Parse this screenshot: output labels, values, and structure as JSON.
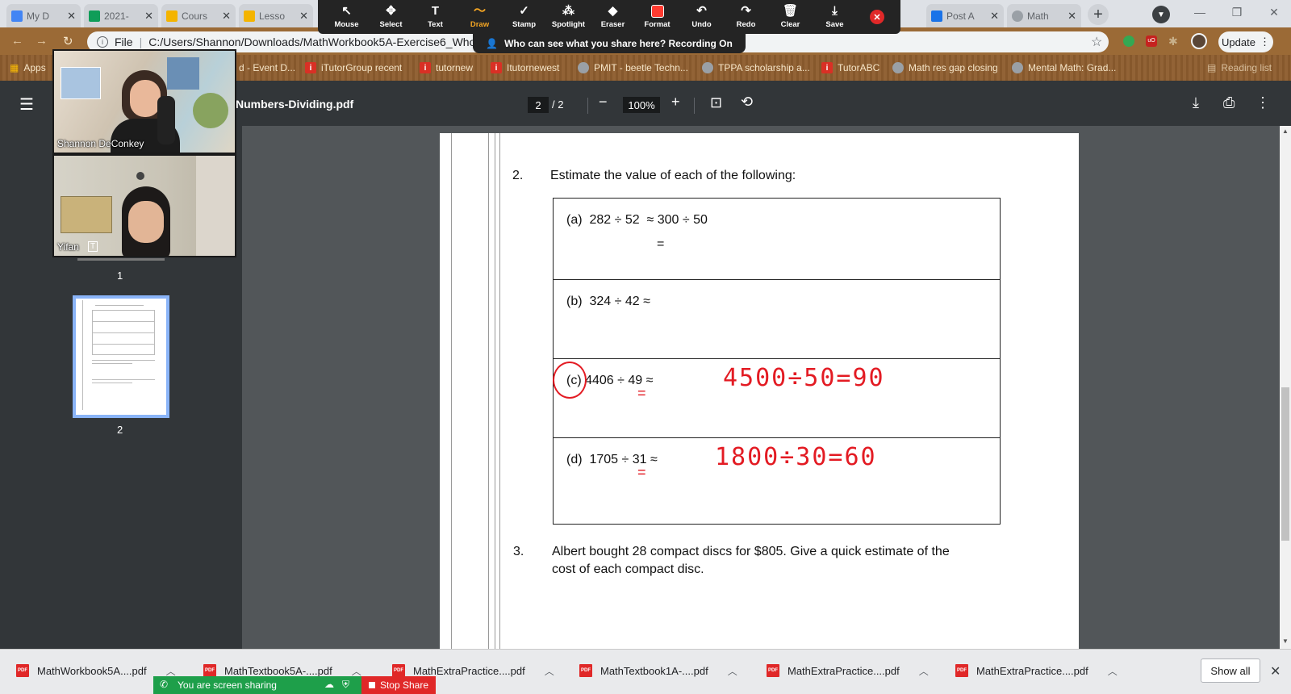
{
  "browser": {
    "tabs": [
      {
        "label": "My D",
        "color": "#4285f4"
      },
      {
        "label": "2021-",
        "color": "#0f9d58"
      },
      {
        "label": "Cours",
        "color": "#f4b400"
      },
      {
        "label": "Lesso",
        "color": "#f4b400"
      },
      {
        "label": "Post A",
        "color": "#1a73e8"
      },
      {
        "label": "Math",
        "color": "#9aa0a6"
      }
    ],
    "url_scheme": "File",
    "url": "C:/Users/Shannon/Downloads/MathWorkbook5A-Exercise6_Whole",
    "update_label": "Update"
  },
  "zoom_toolbar": {
    "tools": [
      {
        "label": "Mouse",
        "icon": "↖",
        "name": "mouse-tool"
      },
      {
        "label": "Select",
        "icon": "✥",
        "name": "select-tool"
      },
      {
        "label": "Text",
        "icon": "T",
        "name": "text-tool"
      },
      {
        "label": "Draw",
        "icon": "〜",
        "name": "draw-tool",
        "active": true
      },
      {
        "label": "Stamp",
        "icon": "✓",
        "name": "stamp-tool"
      },
      {
        "label": "Spotlight",
        "icon": "⁂",
        "name": "spotlight-tool"
      },
      {
        "label": "Eraser",
        "icon": "◆",
        "name": "eraser-tool"
      },
      {
        "label": "Format",
        "icon": "",
        "name": "format-tool"
      },
      {
        "label": "Undo",
        "icon": "↶",
        "name": "undo-tool"
      },
      {
        "label": "Redo",
        "icon": "↷",
        "name": "redo-tool"
      },
      {
        "label": "Clear",
        "icon": "🗑",
        "name": "clear-tool"
      },
      {
        "label": "Save",
        "icon": "⤓",
        "name": "save-tool"
      }
    ],
    "recording_banner": "Who can see what you share here? Recording On",
    "active_color": "#f5a623",
    "format_color": "#ff3b30"
  },
  "bookmarks": [
    {
      "label": "Apps",
      "icon": "grid"
    },
    {
      "label": "d - Event D...",
      "icon": "i"
    },
    {
      "label": "iTutorGroup recent",
      "icon": "i"
    },
    {
      "label": "tutornew",
      "icon": "i"
    },
    {
      "label": "Itutornewest",
      "icon": "i"
    },
    {
      "label": "PMIT - beetle Techn...",
      "icon": "globe"
    },
    {
      "label": "TPPA scholarship a...",
      "icon": "globe"
    },
    {
      "label": "TutorABC",
      "icon": "i"
    },
    {
      "label": "Math res gap closing",
      "icon": "globe"
    },
    {
      "label": "Mental Math: Grad...",
      "icon": "globe"
    },
    {
      "label": "Reading list",
      "icon": "list"
    }
  ],
  "pdf_viewer": {
    "title": "Numbers-Dividing.pdf",
    "current_page": "2",
    "page_of": "/ 2",
    "zoom": "100%",
    "thumb_labels": [
      "1",
      "2"
    ]
  },
  "participants": [
    {
      "name": "Shannon DeConkey"
    },
    {
      "name": "Yifan"
    }
  ],
  "document": {
    "q2": {
      "number": "2.",
      "prompt": "Estimate the value of each of the following:",
      "rows": [
        {
          "label": "(a)",
          "expr": "282 ÷ 52",
          "approx": "≈ 300 ÷ 50",
          "line2": "=",
          "handwritten": ""
        },
        {
          "label": "(b)",
          "expr": "324 ÷ 42",
          "approx": "≈",
          "line2": "",
          "handwritten": ""
        },
        {
          "label": "(c)",
          "expr": "4406 ÷ 49",
          "approx": "≈",
          "line2": "",
          "handwritten": "4500÷50=90"
        },
        {
          "label": "(d)",
          "expr": "1705 ÷ 31",
          "approx": "≈",
          "line2": "",
          "handwritten": "1800÷30=60"
        }
      ]
    },
    "q3": {
      "number": "3.",
      "line1": "Albert bought 28 compact discs for $805. Give a quick estimate of the",
      "line2": "cost of each compact disc."
    },
    "annotation_color": "#e31b23"
  },
  "downloads": [
    "MathWorkbook5A....pdf",
    "MathTextbook5A-....pdf",
    "MathExtraPractice....pdf",
    "MathTextbook1A-....pdf",
    "MathExtraPractice....pdf",
    "MathExtraPractice....pdf"
  ],
  "downloads_show_all": "Show all",
  "screen_share": {
    "status": "You are screen sharing",
    "stop_label": "Stop Share"
  }
}
